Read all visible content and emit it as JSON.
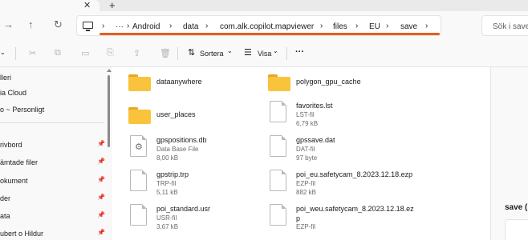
{
  "tabs": {
    "close_glyph": "✕",
    "new_tab_glyph": "+"
  },
  "nav": {
    "back_glyph": "→",
    "up_glyph": "↑",
    "refresh_glyph": "↻"
  },
  "breadcrumb": {
    "overflow": "···",
    "separator": "›",
    "items": [
      "Android",
      "data",
      "com.alk.copilot.mapviewer",
      "files",
      "EU",
      "save"
    ]
  },
  "search": {
    "placeholder": "Sök i save"
  },
  "commandbar": {
    "new_chevron": "⌄",
    "sort_label": "Sortera",
    "view_label": "Visa",
    "more_label": "···",
    "chevron": "⌄"
  },
  "sidebar": {
    "items": [
      {
        "label": "lleri",
        "pinned": false
      },
      {
        "label": "ia Cloud",
        "pinned": false
      },
      {
        "label": "o ~ Personligt",
        "pinned": false
      },
      {
        "label": "rivbord",
        "pinned": true
      },
      {
        "label": "ämtade filer",
        "pinned": true
      },
      {
        "label": "okument",
        "pinned": true
      },
      {
        "label": "der",
        "pinned": true
      },
      {
        "label": "ata",
        "pinned": true
      },
      {
        "label": "ubert o Hildur",
        "pinned": true
      }
    ],
    "pin_glyph": "📌"
  },
  "files": [
    {
      "name": "dataanywhere",
      "kind": "folder"
    },
    {
      "name": "polygon_gpu_cache",
      "kind": "folder"
    },
    {
      "name": "user_places",
      "kind": "folder"
    },
    {
      "name": "favorites.lst",
      "type": "LST-fil",
      "size": "6,79 kB",
      "kind": "file"
    },
    {
      "name": "gpspositions.db",
      "type": "Data Base File",
      "size": "8,00 kB",
      "kind": "db"
    },
    {
      "name": "gpssave.dat",
      "type": "DAT-fil",
      "size": "97 byte",
      "kind": "file"
    },
    {
      "name": "gpstrip.trp",
      "type": "TRP-fil",
      "size": "5,11 kB",
      "kind": "file"
    },
    {
      "name": "poi_eu.safetycam_8.2023.12.18.ezp",
      "type": "EZP-fil",
      "size": "882 kB",
      "kind": "file"
    },
    {
      "name": "poi_standard.usr",
      "type": "USR-fil",
      "size": "3,67 kB",
      "kind": "file"
    },
    {
      "name_line1": "poi_weu.safetycam_8.2023.12.18.ez",
      "name_line2": "p",
      "type": "EZP-fil",
      "kind": "file"
    }
  ],
  "details": {
    "title": "save ("
  },
  "colors": {
    "accent_underline": "#e85d1e",
    "folder": "#f9c43b"
  }
}
